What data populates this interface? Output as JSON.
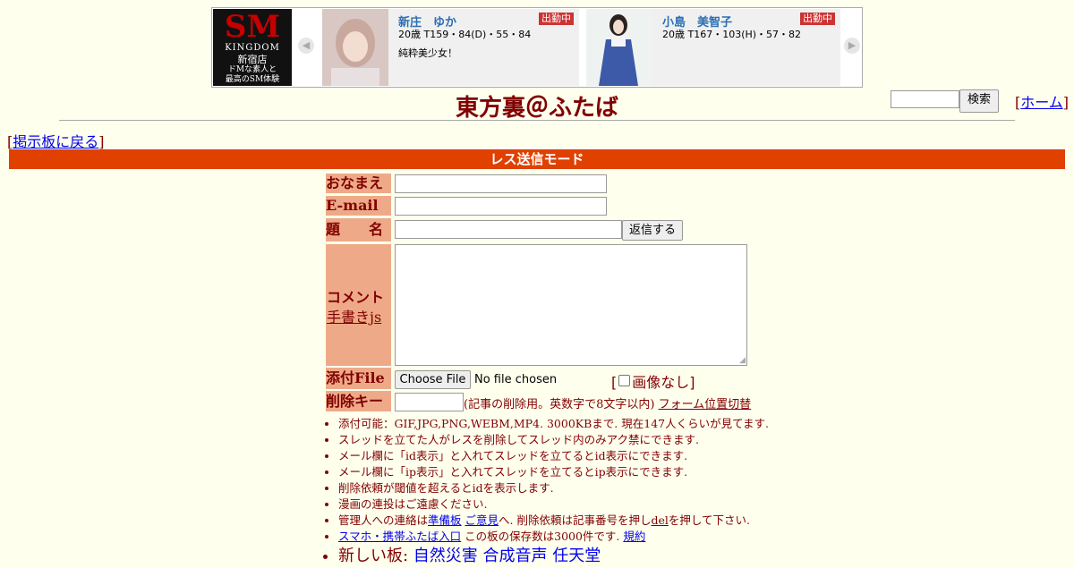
{
  "banner": {
    "logo": {
      "mark": "SM",
      "brand": "KINGDOM",
      "shop": "新宿店",
      "line1": "ドMな素人と",
      "line2": "最高のSM体験"
    },
    "cards": [
      {
        "name": "新庄　ゆか",
        "badge": "出勤中",
        "stats": "20歳 T159・84(D)・55・84",
        "desc": "純粋美少女！"
      },
      {
        "name": "小島　美智子",
        "badge": "出勤中",
        "stats": "20歳 T167・103(H)・57・82",
        "desc": ""
      }
    ],
    "prev_arrow": "◀",
    "next_arrow": "▶"
  },
  "search": {
    "button": "検索",
    "value": ""
  },
  "home": {
    "open": "[",
    "label": "ホーム",
    "close": "]"
  },
  "title": "東方裏＠ふたば",
  "back": {
    "open": "[",
    "label": "掲示板に戻る",
    "close": "]"
  },
  "mode_bar": "レス送信モード",
  "form": {
    "name_label": "おなまえ",
    "email_label": "E-mail",
    "subject_label": "題　　名",
    "submit": "返信する",
    "comment_label": "コメント",
    "comment_link": "手書きjs",
    "file_label": "添付File",
    "file_button": "Choose File",
    "file_status": "No file chosen",
    "no_image_open": "[",
    "no_image": "画像なし",
    "no_image_close": "]",
    "delkey_label": "削除キー",
    "delkey_note": "(記事の削除用。英数字で8文字以内)",
    "form_toggle": "フォーム位置切替"
  },
  "notes": {
    "n1": "添付可能：GIF,JPG,PNG,WEBM,MP4. 3000KBまで. 現在147人くらいが見てます.",
    "n2": "スレッドを立てた人がレスを削除してスレッド内のみアク禁にできます.",
    "n3": "メール欄に「id表示」と入れてスレッドを立てるとid表示にできます.",
    "n4": "メール欄に「ip表示」と入れてスレッドを立てるとip表示にできます.",
    "n5": "削除依頼が閾値を超えるとidを表示します.",
    "n6": "漫画の連投はご遠慮ください.",
    "n7_pre": "管理人への連絡は",
    "n7_link1": "準備板",
    "n7_link2": "ご意見",
    "n7_mid": "へ. 削除依頼は記事番号を押し",
    "n7_del": "del",
    "n7_post": "を押して下さい.",
    "n8_link": "スマホ・携帯ふたば入口",
    "n8_mid": " この板の保存数は3000件です. ",
    "n8_rules": "規約",
    "n9_pre": "新しい板: ",
    "n9_b1": "自然災害",
    "n9_b2": "合成音声",
    "n9_b3": "任天堂"
  }
}
